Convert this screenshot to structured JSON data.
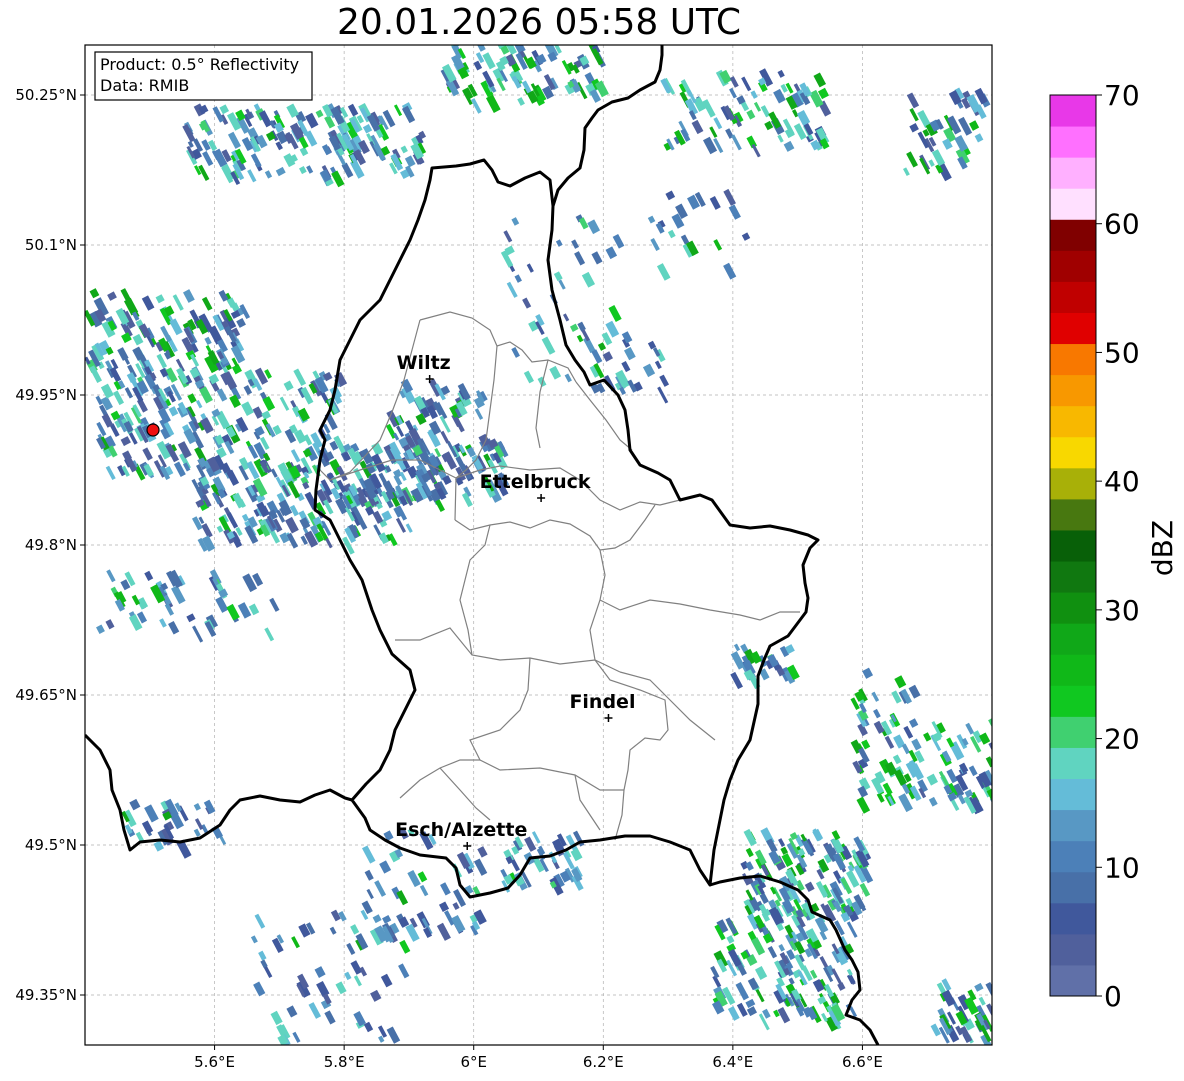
{
  "title": "20.01.2026 05:58 UTC",
  "info_box": {
    "product": "Product: 0.5° Reflectivity",
    "data": "Data: RMIB"
  },
  "map": {
    "lon_range": [
      5.4,
      6.8
    ],
    "lat_range": [
      49.3,
      50.3
    ],
    "lon_ticks": [
      {
        "value": 5.6,
        "label": "5.6°E"
      },
      {
        "value": 5.8,
        "label": "5.8°E"
      },
      {
        "value": 6.0,
        "label": "6°E"
      },
      {
        "value": 6.2,
        "label": "6.2°E"
      },
      {
        "value": 6.4,
        "label": "6.4°E"
      },
      {
        "value": 6.6,
        "label": "6.6°E"
      }
    ],
    "lat_ticks": [
      {
        "value": 50.25,
        "label": "50.25°N"
      },
      {
        "value": 50.1,
        "label": "50.1°N"
      },
      {
        "value": 49.95,
        "label": "49.95°N"
      },
      {
        "value": 49.8,
        "label": "49.8°N"
      },
      {
        "value": 49.65,
        "label": "49.65°N"
      },
      {
        "value": 49.5,
        "label": "49.5°N"
      },
      {
        "value": 49.35,
        "label": "49.35°N"
      }
    ],
    "gridlines": true,
    "radar_site": {
      "lon": 5.505,
      "lat": 49.915
    },
    "cities": [
      {
        "name": "Wiltz",
        "lon": 5.932,
        "lat": 49.966
      },
      {
        "name": "Ettelbruck",
        "lon": 6.104,
        "lat": 49.847
      },
      {
        "name": "Findel",
        "lon": 6.208,
        "lat": 49.627
      },
      {
        "name": "Esch/Alzette",
        "lon": 5.99,
        "lat": 49.499
      }
    ]
  },
  "colorbar": {
    "label": "dBZ",
    "min": 0,
    "max": 70,
    "tick_labels": [
      "0",
      "10",
      "20",
      "30",
      "40",
      "50",
      "60",
      "70"
    ],
    "colors": [
      "#6070a8",
      "#50609c",
      "#40589c",
      "#4870a8",
      "#4c80b8",
      "#5898c4",
      "#64bcd8",
      "#60d4c0",
      "#40d070",
      "#10c820",
      "#10b818",
      "#10a818",
      "#109010",
      "#107810",
      "#086008",
      "#487810",
      "#a8b008",
      "#f8d800",
      "#f8b800",
      "#f89800",
      "#f87800",
      "#e00000",
      "#c00000",
      "#a00000",
      "#800000",
      "#ffe0ff",
      "#ffb0ff",
      "#ff70ff",
      "#e838e8"
    ]
  },
  "colors": {
    "border": "#000000",
    "cantons": "#808080",
    "grid": "#b0b0b0",
    "radar_site": "#ee1111"
  }
}
